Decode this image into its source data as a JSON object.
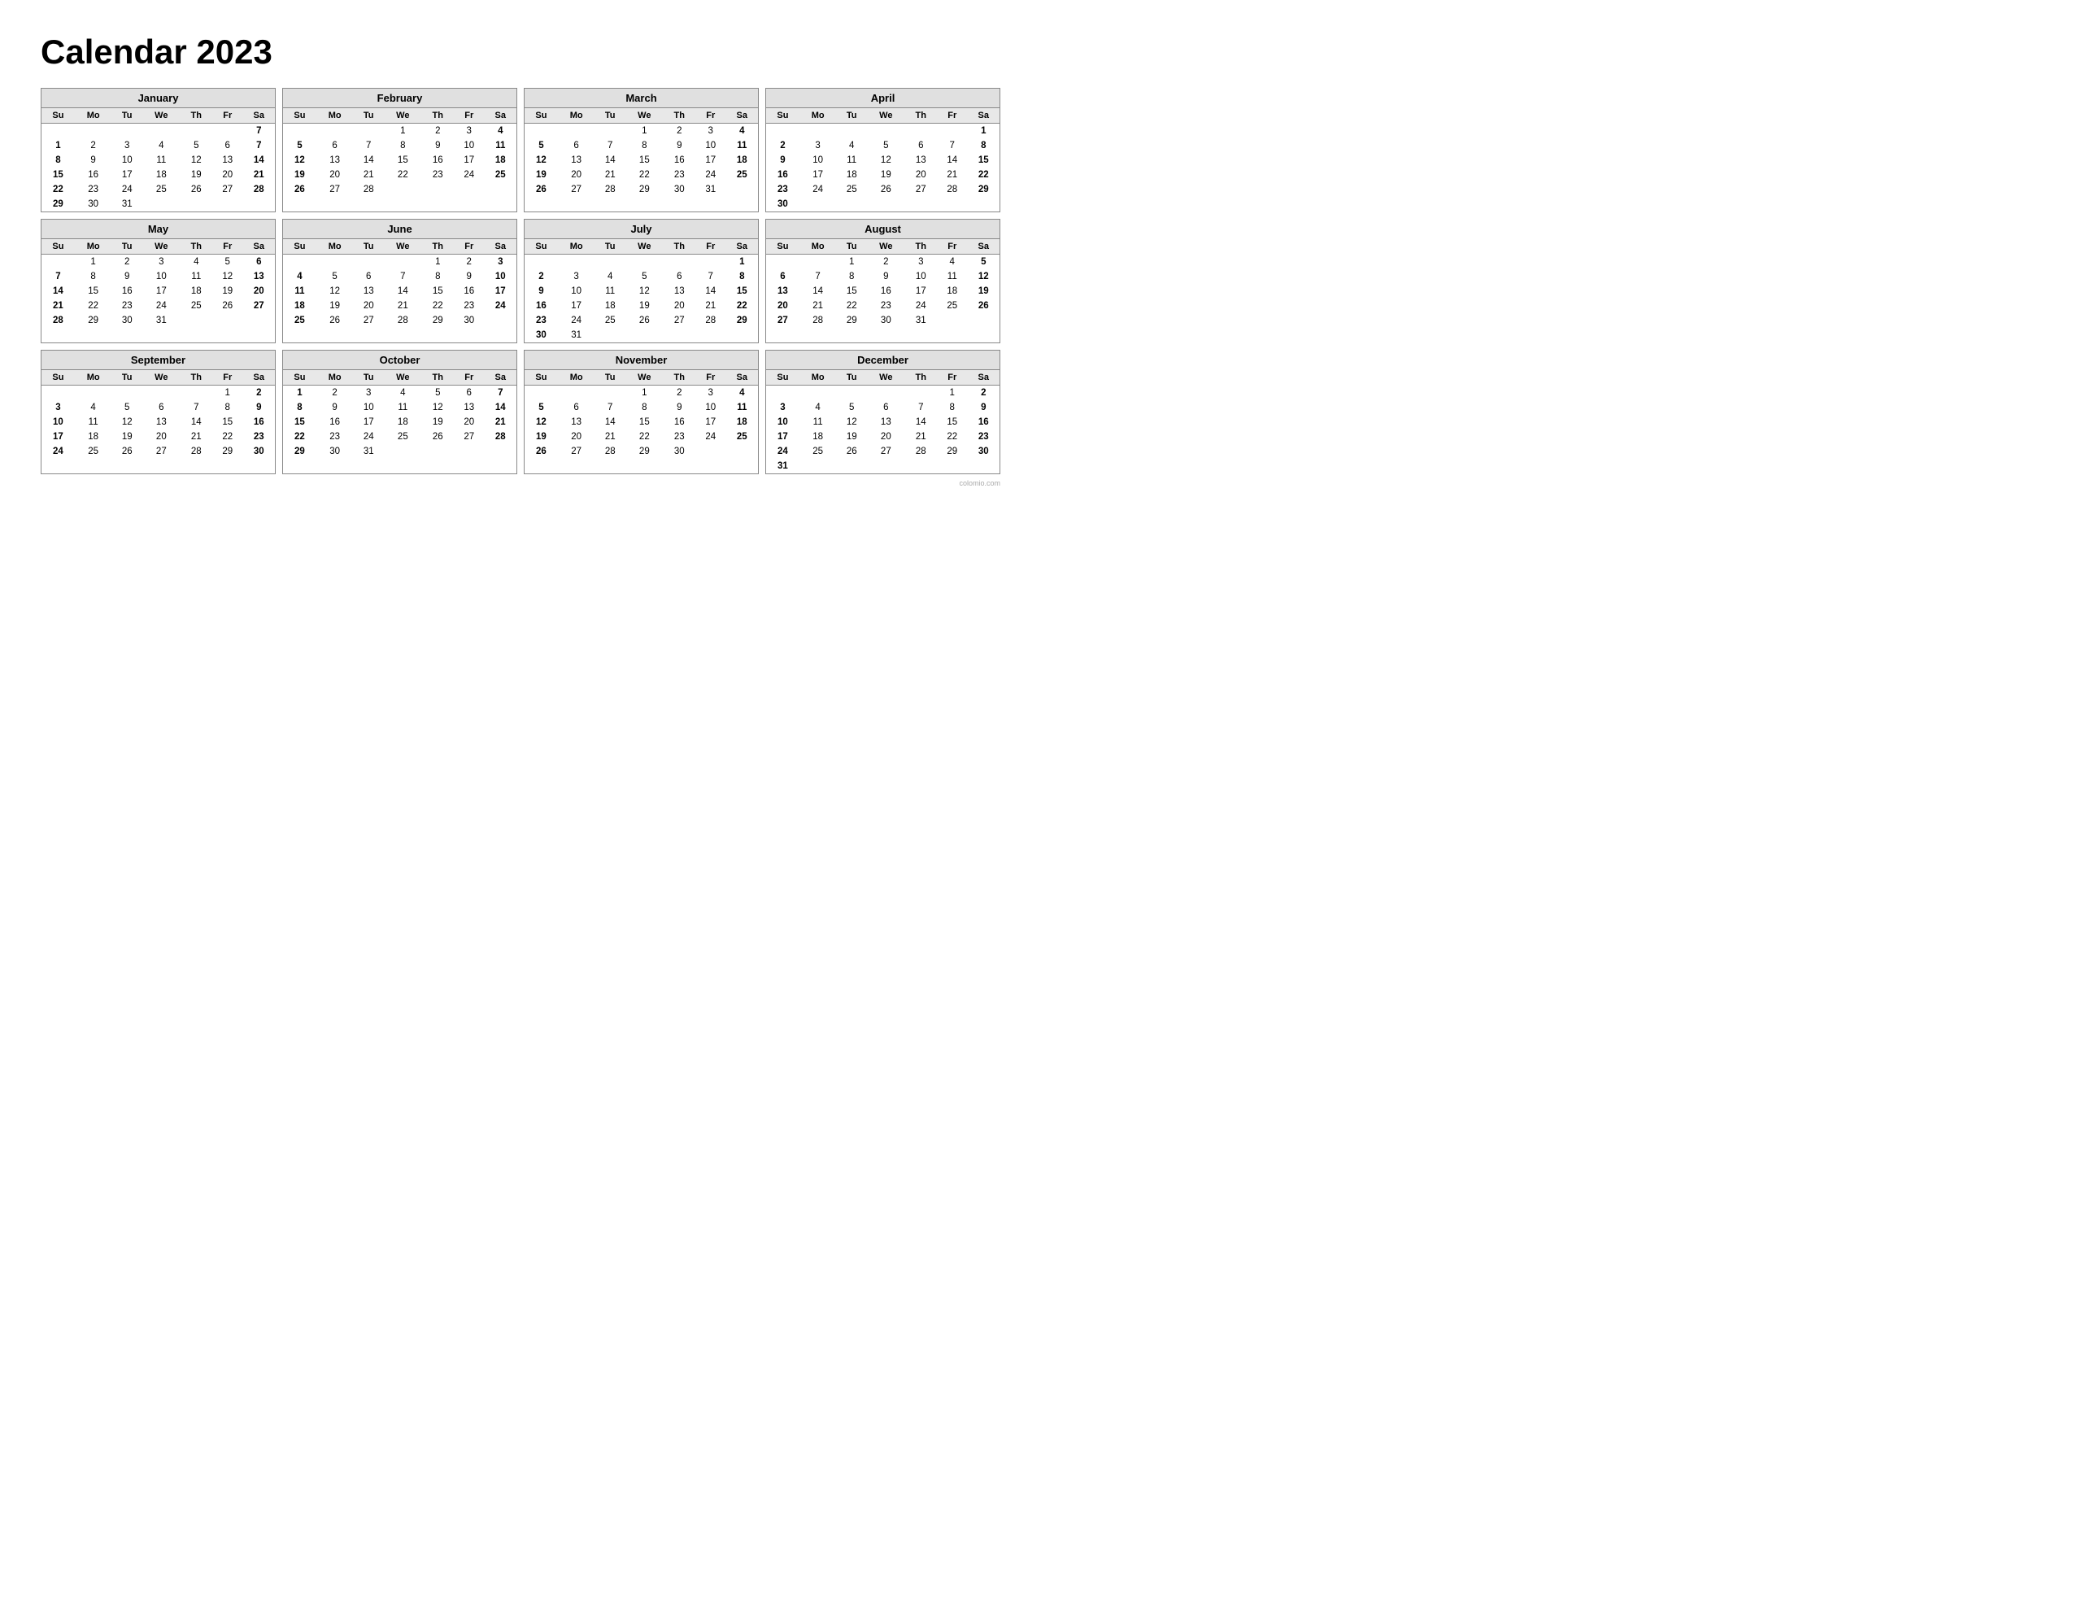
{
  "title": "Calendar 2023",
  "watermark": "colomio.com",
  "months": [
    {
      "name": "January",
      "days": [
        [
          "",
          "",
          "",
          "",
          "",
          "",
          "7"
        ],
        [
          "1",
          "2",
          "3",
          "4",
          "5",
          "6",
          "7"
        ],
        [
          "8",
          "9",
          "10",
          "11",
          "12",
          "13",
          "14"
        ],
        [
          "15",
          "16",
          "17",
          "18",
          "19",
          "20",
          "21"
        ],
        [
          "22",
          "23",
          "24",
          "25",
          "26",
          "27",
          "28"
        ],
        [
          "29",
          "30",
          "31",
          "",
          "",
          "",
          ""
        ]
      ],
      "startDay": 0
    },
    {
      "name": "February",
      "days": [
        [
          "",
          "",
          "",
          "1",
          "2",
          "3",
          "4"
        ],
        [
          "5",
          "6",
          "7",
          "8",
          "9",
          "10",
          "11"
        ],
        [
          "12",
          "13",
          "14",
          "15",
          "16",
          "17",
          "18"
        ],
        [
          "19",
          "20",
          "21",
          "22",
          "23",
          "24",
          "25"
        ],
        [
          "26",
          "27",
          "28",
          "",
          "",
          "",
          ""
        ],
        [
          "",
          "",
          "",
          "",
          "",
          "",
          ""
        ]
      ],
      "startDay": 3
    },
    {
      "name": "March",
      "days": [
        [
          "",
          "",
          "",
          "1",
          "2",
          "3",
          "4"
        ],
        [
          "5",
          "6",
          "7",
          "8",
          "9",
          "10",
          "11"
        ],
        [
          "12",
          "13",
          "14",
          "15",
          "16",
          "17",
          "18"
        ],
        [
          "19",
          "20",
          "21",
          "22",
          "23",
          "24",
          "25"
        ],
        [
          "26",
          "27",
          "28",
          "29",
          "30",
          "31",
          ""
        ],
        [
          "",
          "",
          "",
          "",
          "",
          "",
          ""
        ]
      ],
      "startDay": 3
    },
    {
      "name": "April",
      "days": [
        [
          "",
          "",
          "",
          "",
          "",
          "",
          "1"
        ],
        [
          "2",
          "3",
          "4",
          "5",
          "6",
          "7",
          "8"
        ],
        [
          "9",
          "10",
          "11",
          "12",
          "13",
          "14",
          "15"
        ],
        [
          "16",
          "17",
          "18",
          "19",
          "20",
          "21",
          "22"
        ],
        [
          "23",
          "24",
          "25",
          "26",
          "27",
          "28",
          "29"
        ],
        [
          "30",
          "",
          "",
          "",
          "",
          "",
          ""
        ]
      ],
      "startDay": 6
    },
    {
      "name": "May",
      "days": [
        [
          "",
          "1",
          "2",
          "3",
          "4",
          "5",
          "6"
        ],
        [
          "7",
          "8",
          "9",
          "10",
          "11",
          "12",
          "13"
        ],
        [
          "14",
          "15",
          "16",
          "17",
          "18",
          "19",
          "20"
        ],
        [
          "21",
          "22",
          "23",
          "24",
          "25",
          "26",
          "27"
        ],
        [
          "28",
          "29",
          "30",
          "31",
          "",
          "",
          ""
        ],
        [
          "",
          "",
          "",
          "",
          "",
          "",
          ""
        ]
      ],
      "startDay": 1
    },
    {
      "name": "June",
      "days": [
        [
          "",
          "",
          "",
          "",
          "1",
          "2",
          "3"
        ],
        [
          "4",
          "5",
          "6",
          "7",
          "8",
          "9",
          "10"
        ],
        [
          "11",
          "12",
          "13",
          "14",
          "15",
          "16",
          "17"
        ],
        [
          "18",
          "19",
          "20",
          "21",
          "22",
          "23",
          "24"
        ],
        [
          "25",
          "26",
          "27",
          "28",
          "29",
          "30",
          ""
        ],
        [
          "",
          "",
          "",
          "",
          "",
          "",
          ""
        ]
      ],
      "startDay": 4
    },
    {
      "name": "July",
      "days": [
        [
          "",
          "",
          "",
          "",
          "",
          "",
          "1"
        ],
        [
          "2",
          "3",
          "4",
          "5",
          "6",
          "7",
          "8"
        ],
        [
          "9",
          "10",
          "11",
          "12",
          "13",
          "14",
          "15"
        ],
        [
          "16",
          "17",
          "18",
          "19",
          "20",
          "21",
          "22"
        ],
        [
          "23",
          "24",
          "25",
          "26",
          "27",
          "28",
          "29"
        ],
        [
          "30",
          "31",
          "",
          "",
          "",
          "",
          ""
        ]
      ],
      "startDay": 6
    },
    {
      "name": "August",
      "days": [
        [
          "",
          "",
          "1",
          "2",
          "3",
          "4",
          "5"
        ],
        [
          "6",
          "7",
          "8",
          "9",
          "10",
          "11",
          "12"
        ],
        [
          "13",
          "14",
          "15",
          "16",
          "17",
          "18",
          "19"
        ],
        [
          "20",
          "21",
          "22",
          "23",
          "24",
          "25",
          "26"
        ],
        [
          "27",
          "28",
          "29",
          "30",
          "31",
          "",
          ""
        ],
        [
          "",
          "",
          "",
          "",
          "",
          "",
          ""
        ]
      ],
      "startDay": 2
    },
    {
      "name": "September",
      "days": [
        [
          "",
          "",
          "",
          "",
          "",
          "1",
          "2"
        ],
        [
          "3",
          "4",
          "5",
          "6",
          "7",
          "8",
          "9"
        ],
        [
          "10",
          "11",
          "12",
          "13",
          "14",
          "15",
          "16"
        ],
        [
          "17",
          "18",
          "19",
          "20",
          "21",
          "22",
          "23"
        ],
        [
          "24",
          "25",
          "26",
          "27",
          "28",
          "29",
          "30"
        ],
        [
          "",
          "",
          "",
          "",
          "",
          "",
          ""
        ]
      ],
      "startDay": 5
    },
    {
      "name": "October",
      "days": [
        [
          "1",
          "2",
          "3",
          "4",
          "5",
          "6",
          "7"
        ],
        [
          "8",
          "9",
          "10",
          "11",
          "12",
          "13",
          "14"
        ],
        [
          "15",
          "16",
          "17",
          "18",
          "19",
          "20",
          "21"
        ],
        [
          "22",
          "23",
          "24",
          "25",
          "26",
          "27",
          "28"
        ],
        [
          "29",
          "30",
          "31",
          "",
          "",
          "",
          ""
        ],
        [
          "",
          "",
          "",
          "",
          "",
          "",
          ""
        ]
      ],
      "startDay": 0
    },
    {
      "name": "November",
      "days": [
        [
          "",
          "",
          "",
          "1",
          "2",
          "3",
          "4"
        ],
        [
          "5",
          "6",
          "7",
          "8",
          "9",
          "10",
          "11"
        ],
        [
          "12",
          "13",
          "14",
          "15",
          "16",
          "17",
          "18"
        ],
        [
          "19",
          "20",
          "21",
          "22",
          "23",
          "24",
          "25"
        ],
        [
          "26",
          "27",
          "28",
          "29",
          "30",
          "",
          ""
        ],
        [
          "",
          "",
          "",
          "",
          "",
          "",
          ""
        ]
      ],
      "startDay": 3
    },
    {
      "name": "December",
      "days": [
        [
          "",
          "",
          "",
          "",
          "",
          "1",
          "2"
        ],
        [
          "3",
          "4",
          "5",
          "6",
          "7",
          "8",
          "9"
        ],
        [
          "10",
          "11",
          "12",
          "13",
          "14",
          "15",
          "16"
        ],
        [
          "17",
          "18",
          "19",
          "20",
          "21",
          "22",
          "23"
        ],
        [
          "24",
          "25",
          "26",
          "27",
          "28",
          "29",
          "30"
        ],
        [
          "31",
          "",
          "",
          "",
          "",
          "",
          ""
        ]
      ],
      "startDay": 5
    }
  ],
  "dayHeaders": [
    "Su",
    "Mo",
    "Tu",
    "We",
    "Th",
    "Fr",
    "Sa"
  ]
}
